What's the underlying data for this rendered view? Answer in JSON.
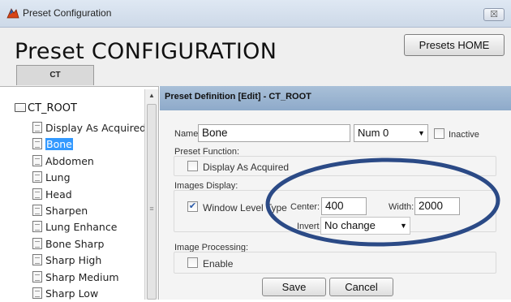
{
  "window": {
    "title": "Preset Configuration",
    "close_label": "☒"
  },
  "header": {
    "page_title": "Preset CONFIGURATION",
    "presets_home_label": "Presets HOME",
    "tab_label": "CT"
  },
  "tree": {
    "root_label": "CT_ROOT",
    "items": [
      {
        "label": "Display As Acquired",
        "selected": false
      },
      {
        "label": "Bone",
        "selected": true
      },
      {
        "label": "Abdomen",
        "selected": false
      },
      {
        "label": "Lung",
        "selected": false
      },
      {
        "label": "Head",
        "selected": false
      },
      {
        "label": "Sharpen",
        "selected": false
      },
      {
        "label": "Lung Enhance",
        "selected": false
      },
      {
        "label": "Bone Sharp",
        "selected": false
      },
      {
        "label": "Sharp High",
        "selected": false
      },
      {
        "label": "Sharp Medium",
        "selected": false
      },
      {
        "label": "Sharp Low",
        "selected": false
      }
    ]
  },
  "panel": {
    "header": "Preset Definition [Edit] - CT_ROOT",
    "name_label": "Name",
    "name_value": "Bone",
    "num_select": "Num 0",
    "inactive_label": "Inactive",
    "inactive_checked": false,
    "preset_function_label": "Preset Function:",
    "display_as_acquired_label": "Display As Acquired",
    "display_as_acquired_checked": false,
    "images_display_label": "Images Display:",
    "window_level_label": "Window Level Type",
    "window_level_checked": true,
    "center_label": "Center:",
    "center_value": "400",
    "width_label": "Width:",
    "width_value": "2000",
    "invert_label": "Invert",
    "invert_select": "No change",
    "image_processing_label": "Image Processing:",
    "enable_label": "Enable",
    "enable_checked": false,
    "save_label": "Save",
    "cancel_label": "Cancel"
  },
  "colors": {
    "panel_header": "#9db6d1",
    "selection": "#3399ff",
    "annotation": "#2b4a86"
  }
}
